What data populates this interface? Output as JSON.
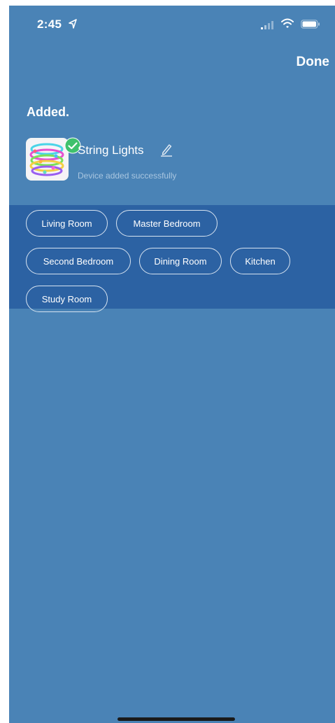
{
  "status_bar": {
    "time": "2:45"
  },
  "nav": {
    "done_label": "Done"
  },
  "page": {
    "title": "Added."
  },
  "device": {
    "name": "String Lights",
    "status": "Device added successfully"
  },
  "rooms": [
    {
      "label": "Living Room"
    },
    {
      "label": "Master Bedroom"
    },
    {
      "label": "Second Bedroom"
    },
    {
      "label": "Dining Room"
    },
    {
      "label": "Kitchen"
    },
    {
      "label": "Study Room"
    }
  ],
  "colors": {
    "background": "#4a83b6",
    "rooms_panel": "#2c62a3",
    "chip_border": "#d7e3f0",
    "success_badge": "#3fc16d",
    "secondary_text": "#a9c6e0"
  }
}
